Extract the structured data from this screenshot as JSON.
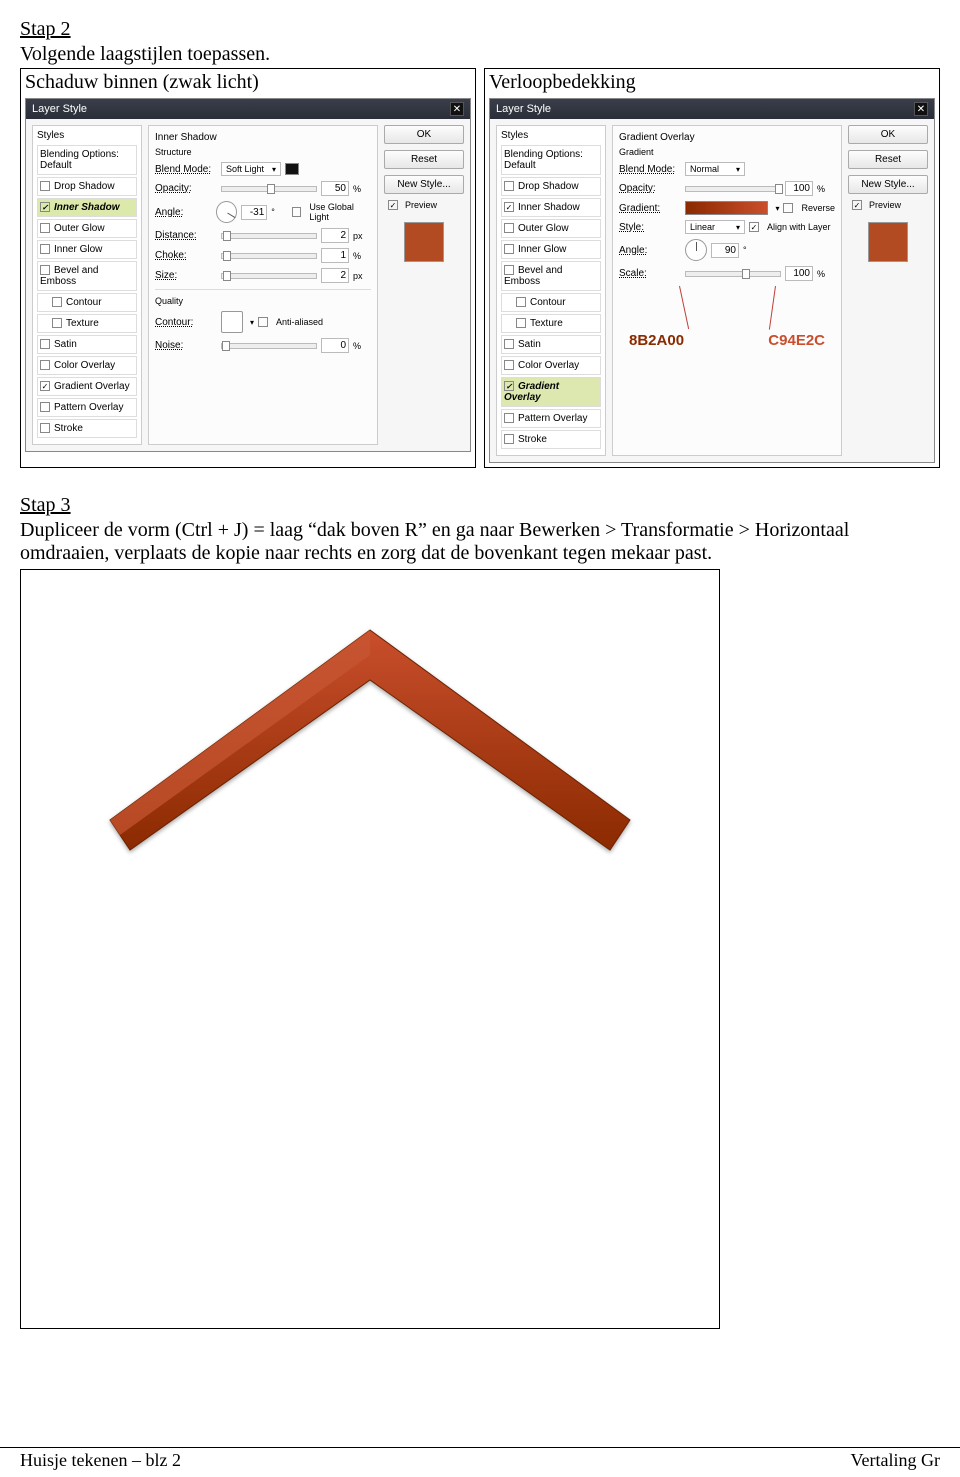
{
  "doc": {
    "step2": {
      "title": "Stap 2",
      "line1": "Volgende laagstijlen toepassen.",
      "left_head": "Schaduw binnen (zwak licht)",
      "right_head": "Verloopbedekking"
    },
    "step3": {
      "title": "Stap 3",
      "para": "Dupliceer de vorm (Ctrl + J) = laag “dak boven R” en ga naar Bewerken > Transformatie  > Horizontaal omdraaien, verplaats de kopie naar rechts en zorg dat de bovenkant tegen mekaar past."
    },
    "footer": {
      "left": "Huisje tekenen – blz 2",
      "right": "Vertaling Gr"
    }
  },
  "dialog_common": {
    "title": "Layer Style",
    "styles_title": "Styles",
    "blending_options": "Blending Options: Default",
    "style_list": [
      "Drop Shadow",
      "Inner Shadow",
      "Outer Glow",
      "Inner Glow",
      "Bevel and Emboss",
      "Contour",
      "Texture",
      "Satin",
      "Color Overlay",
      "Gradient Overlay",
      "Pattern Overlay",
      "Stroke"
    ],
    "buttons": {
      "ok": "OK",
      "reset": "Reset",
      "new_style": "New Style...",
      "preview": "Preview"
    }
  },
  "inner_shadow": {
    "section1": "Inner Shadow",
    "struct": "Structure",
    "blend_mode_label": "Blend Mode:",
    "blend_mode": "Soft Light",
    "opacity_label": "Opacity:",
    "opacity": "50",
    "opacity_unit": "%",
    "angle_label": "Angle:",
    "angle": "-31",
    "use_global": "Use Global Light",
    "distance_label": "Distance:",
    "distance": "2",
    "choke_label": "Choke:",
    "choke": "1",
    "size_label": "Size:",
    "size": "2",
    "px": "px",
    "pct": "%",
    "quality": "Quality",
    "contour_label": "Contour:",
    "antialiased": "Anti-aliased",
    "noise_label": "Noise:",
    "noise": "0"
  },
  "gradient_overlay": {
    "section1": "Gradient Overlay",
    "gradient_head": "Gradient",
    "blend_mode_label": "Blend Mode:",
    "blend_mode": "Normal",
    "opacity_label": "Opacity:",
    "opacity": "100",
    "pct": "%",
    "gradient_label": "Gradient:",
    "reverse": "Reverse",
    "style_label": "Style:",
    "style": "Linear",
    "align": "Align with Layer",
    "angle_label": "Angle:",
    "angle": "90",
    "deg": "°",
    "scale_label": "Scale:",
    "scale": "100",
    "stops": {
      "left": "8B2A00",
      "right": "C94E2C"
    }
  },
  "checked_left": [
    "Inner Shadow",
    "Gradient Overlay"
  ],
  "checked_right": [
    "Inner Shadow",
    "Gradient Overlay"
  ],
  "swatch_color": "#B24A22"
}
